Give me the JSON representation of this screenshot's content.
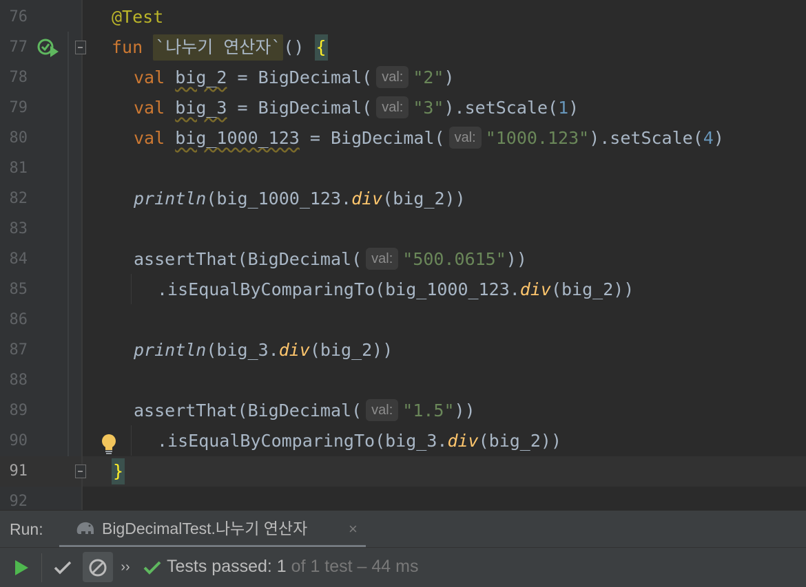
{
  "editor": {
    "current_line": "91",
    "lines": [
      {
        "num": "76"
      },
      {
        "num": "77"
      },
      {
        "num": "78"
      },
      {
        "num": "79"
      },
      {
        "num": "80"
      },
      {
        "num": "81"
      },
      {
        "num": "82"
      },
      {
        "num": "83"
      },
      {
        "num": "84"
      },
      {
        "num": "85"
      },
      {
        "num": "86"
      },
      {
        "num": "87"
      },
      {
        "num": "88"
      },
      {
        "num": "89"
      },
      {
        "num": "90"
      },
      {
        "num": "91"
      },
      {
        "num": "92"
      }
    ],
    "code": {
      "annotation": "@Test",
      "kw_fun": "fun",
      "function_name": "`나누기 연산자`",
      "parens_open": "() ",
      "brace_open": "{",
      "kw_val": "val",
      "var_big2": "big_2",
      "var_big3": "big_3",
      "var_big1000": "big_1000_123",
      "eq_ctor": " = BigDecimal(",
      "hint_val": "val:",
      "str_2": "\"2\"",
      "str_3": "\"3\"",
      "str_1000": "\"1000.123\"",
      "close_paren": ")",
      "set_scale": ").setScale(",
      "num_1": "1",
      "num_4": "4",
      "println": "println",
      "arg_big1000": "(big_1000_123.",
      "div": "div",
      "arg_big2_close": "(big_2))",
      "assert_ctor": "assertThat(BigDecimal(",
      "str_500": "\"500.0615\"",
      "close_two": "))",
      "is_equal_1000": ".isEqualByComparingTo(big_1000_123.",
      "arg_big3": "(big_3.",
      "str_15": "\"1.5\"",
      "is_equal_3": ".isEqualByComparingTo(big_3.",
      "brace_close": "}"
    },
    "gutter_icons": {
      "run_test": "run-test-passed-icon",
      "fold": "fold-icon",
      "intention": "lightbulb-icon"
    }
  },
  "run_panel": {
    "label": "Run:",
    "tab_title": "BigDecimalTest.나누기 연산자",
    "tab_close": "×",
    "status_prefix": "Tests passed: 1",
    "status_suffix": " of 1 test – 44 ms",
    "more": "››"
  },
  "colors": {
    "editor_bg": "#2b2b2b",
    "keyword": "#cc7832",
    "string": "#6a8759",
    "number": "#6897bb",
    "extension_fn": "#ffc66d",
    "pass_green": "#5fb85f"
  }
}
